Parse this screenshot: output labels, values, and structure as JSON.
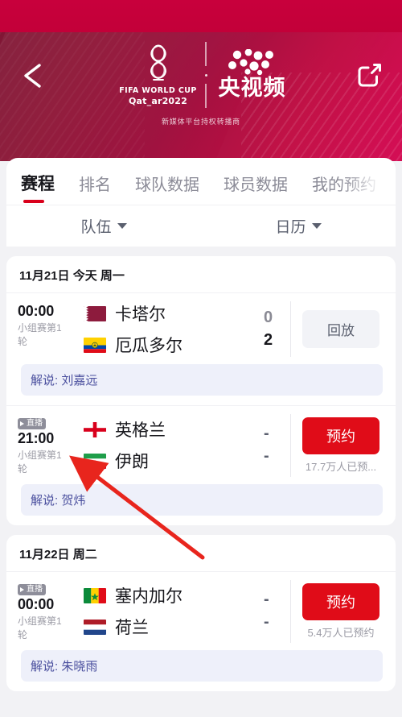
{
  "header": {
    "back_icon": "chevron-left-icon",
    "share_icon": "share-external-icon",
    "fifa_line1": "FIFA WORLD CUP",
    "fifa_line2": "Qat_ar2022",
    "cctv_name": "央视频",
    "subtitle": "新媒体平台持权转播商",
    "bg_color": "#a01240",
    "bg_color_top": "#c8003c"
  },
  "tabs": [
    {
      "label": "赛程",
      "active": true
    },
    {
      "label": "排名",
      "active": false
    },
    {
      "label": "球队数据",
      "active": false
    },
    {
      "label": "球员数据",
      "active": false
    },
    {
      "label": "我的预约",
      "active": false
    }
  ],
  "filters": [
    {
      "label": "队伍",
      "icon": "chevron-down-icon"
    },
    {
      "label": "日历",
      "icon": "chevron-down-icon"
    }
  ],
  "days": [
    {
      "date_label": "11月21日 今天 周一",
      "matches": [
        {
          "live": false,
          "live_label": "直播",
          "time": "00:00",
          "stage": "小组赛第1轮",
          "home": {
            "name": "卡塔尔",
            "flag": "qatar",
            "score": "0"
          },
          "away": {
            "name": "厄瓜多尔",
            "flag": "ecuador",
            "score": "2"
          },
          "action": {
            "type": "replay",
            "label": "回放",
            "count": ""
          },
          "commentary": "解说: 刘嘉远"
        },
        {
          "live": true,
          "live_label": "直播",
          "time": "21:00",
          "stage": "小组赛第1轮",
          "home": {
            "name": "英格兰",
            "flag": "england",
            "score": "-"
          },
          "away": {
            "name": "伊朗",
            "flag": "iran",
            "score": "-"
          },
          "action": {
            "type": "book",
            "label": "预约",
            "count": "17.7万人已预..."
          },
          "commentary": "解说: 贺炜"
        }
      ]
    },
    {
      "date_label": "11月22日 周二",
      "matches": [
        {
          "live": true,
          "live_label": "直播",
          "time": "00:00",
          "stage": "小组赛第1轮",
          "home": {
            "name": "塞内加尔",
            "flag": "senegal",
            "score": "-"
          },
          "away": {
            "name": "荷兰",
            "flag": "netherlands",
            "score": "-"
          },
          "action": {
            "type": "book",
            "label": "预约",
            "count": "5.4万人已预约"
          },
          "commentary": "解说: 朱晓雨"
        }
      ]
    }
  ],
  "annotation": {
    "type": "arrow",
    "color": "#e8251d",
    "points_to": "21:00 live match time"
  }
}
